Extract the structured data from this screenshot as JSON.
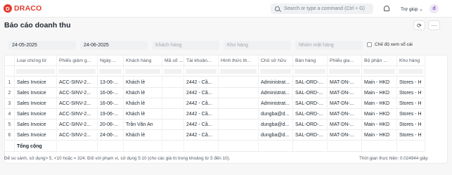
{
  "navbar": {
    "logo_letter": "D",
    "brand": "DRACO",
    "search_placeholder": "Search or type a command (Ctrl + G)",
    "help_label": "Trợ giúp",
    "avatar_initial": "d"
  },
  "page": {
    "title": "Báo cáo doanh thu",
    "refresh_glyph": "⟳",
    "menu_glyph": "···"
  },
  "filters": {
    "from_date": "24-05-2025",
    "to_date": "24-06-2025",
    "customer_placeholder": "Khách hàng",
    "warehouse_placeholder": "Kho hàng",
    "item_group_placeholder": "Nhóm mặt hàng",
    "ledger_mode_label": "Chế độ xem sổ cái"
  },
  "table": {
    "columns": [
      "",
      "Loại chứng từ",
      "Phiếu giảm g...",
      "Ngày ...",
      "Khách hàng",
      "Mã số ...",
      "Tài khoản...",
      "Hình thức th...",
      "Chủ sở hữu",
      "Bán hàng",
      "Phiếu gia...",
      "Bộ phận ...",
      "Kho hàng"
    ],
    "rows": [
      [
        "1",
        "Sales Invoice",
        "ACC-SINV-2...",
        "13-06-...",
        "Khách lẻ",
        "",
        "2442 - Cầ...",
        "",
        "Administrat...",
        "SAL-ORD-...",
        "MAT-DN-...",
        "Main - HKD",
        "Stores - H"
      ],
      [
        "2",
        "Sales Invoice",
        "ACC-SINV-2...",
        "16-06-...",
        "Khách lẻ",
        "",
        "2442 - Cầ...",
        "",
        "Administrat...",
        "SAL-ORD-...",
        "MAT-DN-...",
        "Main - HKD",
        "Stores - H"
      ],
      [
        "3",
        "Sales Invoice",
        "ACC-SINV-2...",
        "16-06-...",
        "Khách lẻ",
        "",
        "2442 - Cầ...",
        "",
        "Administrat...",
        "SAL-ORD-...",
        "MAT-DN-...",
        "Main - HKD",
        "Stores - H"
      ],
      [
        "4",
        "Sales Invoice",
        "ACC-SINV-2...",
        "19-06-...",
        "Khách lẻ",
        "",
        "2442 - Cầ...",
        "",
        "dungba@d...",
        "SAL-ORD-...",
        "MAT-DN-...",
        "Main - HKD",
        "Stores - H"
      ],
      [
        "5",
        "Sales Invoice",
        "ACC-SINV-2...",
        "20-06-...",
        "Trần Văn An",
        "",
        "2442 - Cầ...",
        "",
        "dungba@d...",
        "SAL-ORD-...",
        "MAT-DN-...",
        "Main - HKD",
        "Stores - H"
      ],
      [
        "6",
        "Sales Invoice",
        "ACC-SINV-2...",
        "24-06-...",
        "Khách lẻ",
        "",
        "2442 - Cầ...",
        "",
        "dungba@d...",
        "SAL-ORD-...",
        "MAT-DN-...",
        "Main - HKD",
        "Stores - H"
      ]
    ],
    "total_label": "Tổng cộng"
  },
  "footer": {
    "note": "Để so sánh, sử dụng> 5, <10 hoặc = 324. Đối với phạm vi, sử dụng 5:10 (cho các giá trị trong khoảng từ 5 đến 10).",
    "exec_time": "Thời gian thực hiện: 0.024944 giây"
  }
}
